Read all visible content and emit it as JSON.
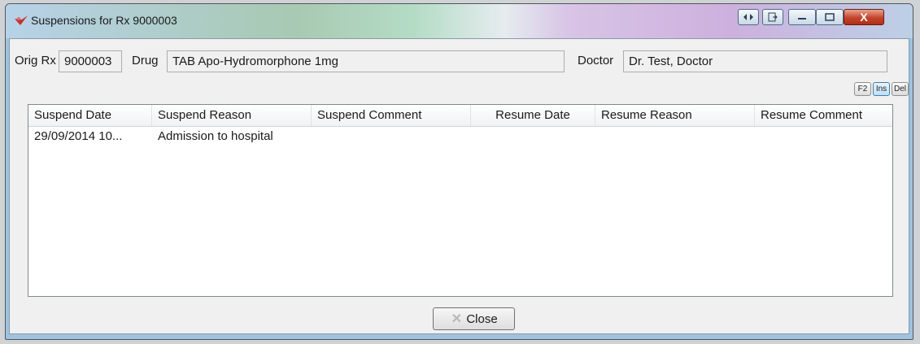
{
  "window": {
    "title": "Suspensions for Rx 9000003",
    "icons": [
      "app-icon",
      "resize-arrows-icon",
      "export-icon",
      "minimize-icon",
      "maximize-icon",
      "close-icon"
    ],
    "close_glyph": "X"
  },
  "header": {
    "orig_rx_label": "Orig Rx",
    "orig_rx_value": "9000003",
    "drug_label": "Drug",
    "drug_value": "TAB Apo-Hydromorphone 1mg",
    "doctor_label": "Doctor",
    "doctor_value": "Dr. Test, Doctor"
  },
  "toolbar": {
    "f2_label": "F2",
    "ins_label": "Ins",
    "del_label": "Del"
  },
  "table": {
    "columns": [
      "Suspend Date",
      "Suspend Reason",
      "Suspend Comment",
      "Resume Date",
      "Resume Reason",
      "Resume Comment"
    ],
    "rows": [
      [
        "29/09/2014 10...",
        "Admission to hospital",
        "",
        "",
        "",
        ""
      ]
    ]
  },
  "footer": {
    "close_label": "Close"
  },
  "colors": {
    "accent": "#3c7fb1",
    "close_button": "#c3442c"
  }
}
